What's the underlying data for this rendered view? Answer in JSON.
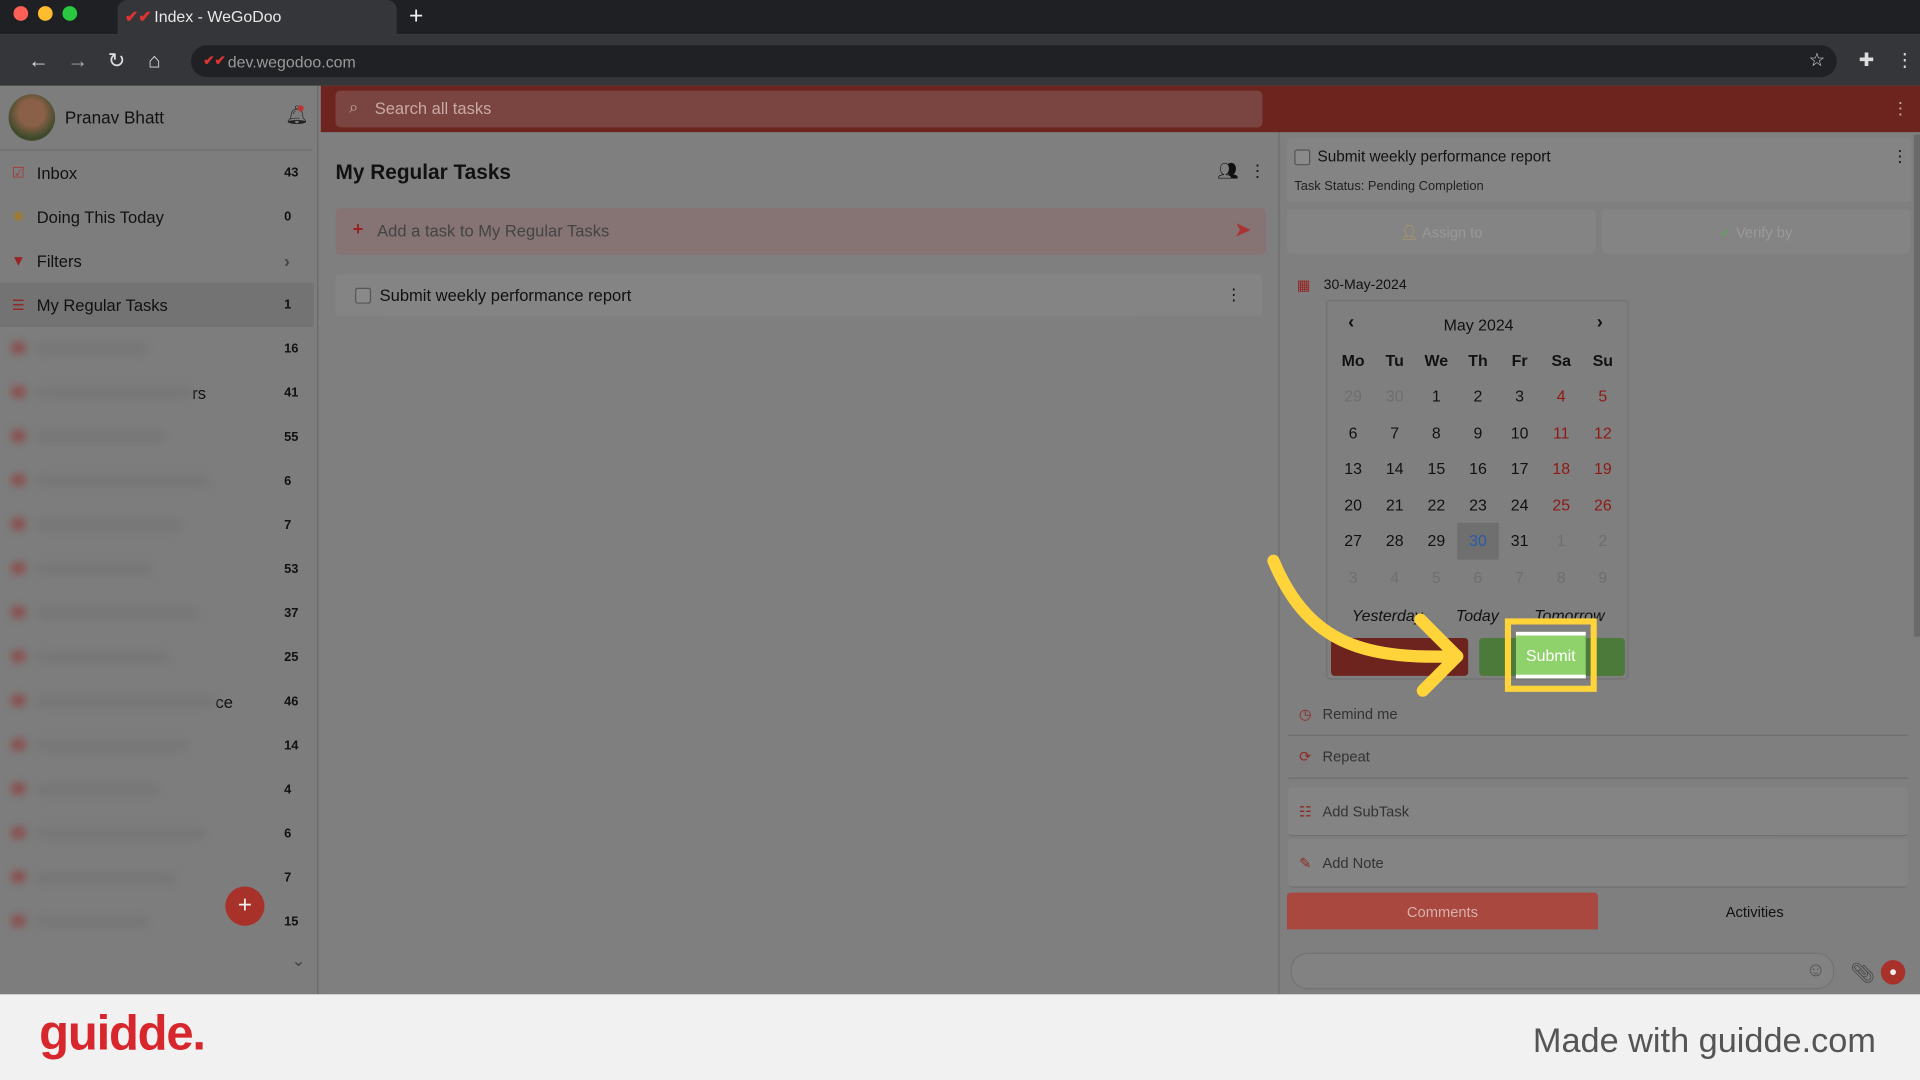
{
  "browser": {
    "tab_title": "Index - WeGoDoo",
    "url": "dev.wegodoo.com"
  },
  "user": {
    "name": "Pranav Bhatt"
  },
  "sidebar": {
    "items": [
      {
        "label": "Inbox",
        "count": "43",
        "icon": "checkbox-icon"
      },
      {
        "label": "Doing This Today",
        "count": "0",
        "icon": "sun-icon"
      },
      {
        "label": "Filters",
        "count": "",
        "icon": "filter-icon"
      },
      {
        "label": "My Regular Tasks",
        "count": "1",
        "icon": "list-icon"
      }
    ],
    "blurred_counts": [
      "16",
      "41",
      "55",
      "6",
      "7",
      "53",
      "37",
      "25",
      "46",
      "14",
      "4",
      "6",
      "7",
      "15"
    ],
    "fragments": {
      "r1": "rs",
      "r8": "ce"
    }
  },
  "search": {
    "placeholder": "Search all tasks"
  },
  "main": {
    "title": "My Regular Tasks",
    "add_placeholder": "Add a task to My Regular Tasks",
    "tasks": [
      {
        "title": "Submit weekly performance report"
      }
    ]
  },
  "detail": {
    "title": "Submit weekly performance report",
    "status": "Task Status: Pending Completion",
    "assign": "Assign to",
    "verify": "Verify by",
    "date": "30-May-2024",
    "calendar": {
      "month": "May 2024",
      "days": [
        "Mo",
        "Tu",
        "We",
        "Th",
        "Fr",
        "Sa",
        "Su"
      ],
      "weeks": [
        [
          "29",
          "30",
          "1",
          "2",
          "3",
          "4",
          "5"
        ],
        [
          "6",
          "7",
          "8",
          "9",
          "10",
          "11",
          "12"
        ],
        [
          "13",
          "14",
          "15",
          "16",
          "17",
          "18",
          "19"
        ],
        [
          "20",
          "21",
          "22",
          "23",
          "24",
          "25",
          "26"
        ],
        [
          "27",
          "28",
          "29",
          "30",
          "31",
          "1",
          "2"
        ],
        [
          "3",
          "4",
          "5",
          "6",
          "7",
          "8",
          "9"
        ]
      ],
      "selected": "30",
      "quick": [
        "Yesterday",
        "Today",
        "Tomorrow"
      ],
      "submit": "Submit"
    },
    "remind": "Remind me",
    "repeat": "Repeat",
    "subtask": "Add SubTask",
    "note": "Add Note",
    "tabs": [
      "Comments",
      "Activities"
    ]
  },
  "colors": {
    "accent": "#c0392b",
    "submit": "#8fd16a",
    "highlight": "#ffd43b"
  },
  "footer": {
    "logo": "guidde.",
    "tagline": "Made with guidde.com"
  }
}
